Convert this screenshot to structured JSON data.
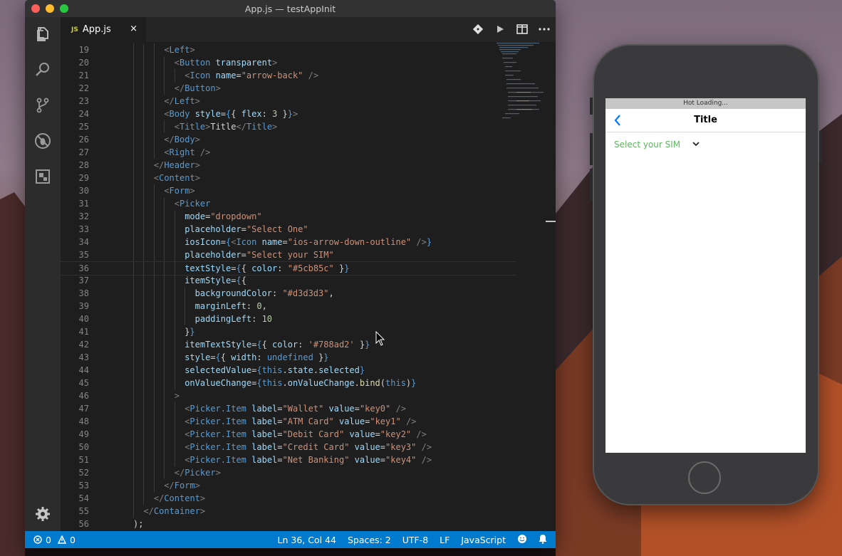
{
  "window": {
    "title": "App.js — testAppInit"
  },
  "tab": {
    "badge": "JS",
    "name": "App.js",
    "close": "×"
  },
  "icons": {
    "activity": [
      "explorer-icon",
      "search-icon",
      "source-control-icon",
      "debug-icon",
      "extensions-icon",
      "settings-gear-icon"
    ],
    "toolbar": [
      "git-compare-icon",
      "run-icon",
      "split-editor-icon",
      "more-actions-icon"
    ]
  },
  "lines": [
    {
      "n": "19",
      "i": 5,
      "t": [
        [
          "tg",
          "<"
        ],
        [
          "tn",
          "Left"
        ],
        [
          "tg",
          ">"
        ]
      ]
    },
    {
      "n": "20",
      "i": 6,
      "t": [
        [
          "tg",
          "<"
        ],
        [
          "tn",
          "Button"
        ],
        [
          "pl",
          " "
        ],
        [
          "at",
          "transparent"
        ],
        [
          "tg",
          ">"
        ]
      ]
    },
    {
      "n": "21",
      "i": 7,
      "t": [
        [
          "tg",
          "<"
        ],
        [
          "tn",
          "Icon"
        ],
        [
          "pl",
          " "
        ],
        [
          "at",
          "name"
        ],
        [
          "pl",
          "="
        ],
        [
          "st",
          "\"arrow-back\""
        ],
        [
          "pl",
          " "
        ],
        [
          "tg",
          "/>"
        ]
      ]
    },
    {
      "n": "22",
      "i": 6,
      "t": [
        [
          "tg",
          "</"
        ],
        [
          "tn",
          "Button"
        ],
        [
          "tg",
          ">"
        ]
      ]
    },
    {
      "n": "23",
      "i": 5,
      "t": [
        [
          "tg",
          "</"
        ],
        [
          "tn",
          "Left"
        ],
        [
          "tg",
          ">"
        ]
      ]
    },
    {
      "n": "24",
      "i": 5,
      "t": [
        [
          "tg",
          "<"
        ],
        [
          "tn",
          "Body"
        ],
        [
          "pl",
          " "
        ],
        [
          "at",
          "style"
        ],
        [
          "pl",
          "="
        ],
        [
          "kw",
          "{"
        ],
        [
          "pl",
          "{ "
        ],
        [
          "at",
          "flex"
        ],
        [
          "pl",
          ": "
        ],
        [
          "nm",
          "3"
        ],
        [
          "pl",
          " }"
        ],
        [
          "kw",
          "}"
        ],
        [
          "tg",
          ">"
        ]
      ]
    },
    {
      "n": "25",
      "i": 6,
      "t": [
        [
          "tg",
          "<"
        ],
        [
          "tn",
          "Title"
        ],
        [
          "tg",
          ">"
        ],
        [
          "pl",
          "Title"
        ],
        [
          "tg",
          "</"
        ],
        [
          "tn",
          "Title"
        ],
        [
          "tg",
          ">"
        ]
      ]
    },
    {
      "n": "26",
      "i": 5,
      "t": [
        [
          "tg",
          "</"
        ],
        [
          "tn",
          "Body"
        ],
        [
          "tg",
          ">"
        ]
      ]
    },
    {
      "n": "27",
      "i": 5,
      "t": [
        [
          "tg",
          "<"
        ],
        [
          "tn",
          "Right"
        ],
        [
          "pl",
          " "
        ],
        [
          "tg",
          "/>"
        ]
      ]
    },
    {
      "n": "28",
      "i": 4,
      "t": [
        [
          "tg",
          "</"
        ],
        [
          "tn",
          "Header"
        ],
        [
          "tg",
          ">"
        ]
      ]
    },
    {
      "n": "29",
      "i": 4,
      "t": [
        [
          "tg",
          "<"
        ],
        [
          "tn",
          "Content"
        ],
        [
          "tg",
          ">"
        ]
      ]
    },
    {
      "n": "30",
      "i": 5,
      "t": [
        [
          "tg",
          "<"
        ],
        [
          "tn",
          "Form"
        ],
        [
          "tg",
          ">"
        ]
      ]
    },
    {
      "n": "31",
      "i": 6,
      "t": [
        [
          "tg",
          "<"
        ],
        [
          "tn",
          "Picker"
        ]
      ]
    },
    {
      "n": "32",
      "i": 7,
      "t": [
        [
          "at",
          "mode"
        ],
        [
          "pl",
          "="
        ],
        [
          "st",
          "\"dropdown\""
        ]
      ]
    },
    {
      "n": "33",
      "i": 7,
      "t": [
        [
          "at",
          "placeholder"
        ],
        [
          "pl",
          "="
        ],
        [
          "st",
          "\"Select One\""
        ]
      ]
    },
    {
      "n": "34",
      "i": 7,
      "t": [
        [
          "at",
          "iosIcon"
        ],
        [
          "pl",
          "="
        ],
        [
          "kw",
          "{"
        ],
        [
          "tg",
          "<"
        ],
        [
          "tn",
          "Icon"
        ],
        [
          "pl",
          " "
        ],
        [
          "at",
          "name"
        ],
        [
          "pl",
          "="
        ],
        [
          "st",
          "\"ios-arrow-down-outline\""
        ],
        [
          "pl",
          " "
        ],
        [
          "tg",
          "/>"
        ],
        [
          "kw",
          "}"
        ]
      ]
    },
    {
      "n": "35",
      "i": 7,
      "t": [
        [
          "at",
          "placeholder"
        ],
        [
          "pl",
          "="
        ],
        [
          "st",
          "\"Select your SIM\""
        ]
      ]
    },
    {
      "n": "36",
      "i": 7,
      "t": [
        [
          "at",
          "textStyle"
        ],
        [
          "pl",
          "="
        ],
        [
          "kw",
          "{"
        ],
        [
          "pl",
          "{ "
        ],
        [
          "at",
          "color"
        ],
        [
          "pl",
          ": "
        ],
        [
          "st",
          "\"#5cb85c\""
        ],
        [
          "pl",
          " }"
        ],
        [
          "kw",
          "}"
        ]
      ]
    },
    {
      "n": "37",
      "i": 7,
      "t": [
        [
          "at",
          "itemStyle"
        ],
        [
          "pl",
          "="
        ],
        [
          "kw",
          "{"
        ],
        [
          "pl",
          "{"
        ]
      ]
    },
    {
      "n": "38",
      "i": 8,
      "t": [
        [
          "at",
          "backgroundColor"
        ],
        [
          "pl",
          ": "
        ],
        [
          "st",
          "\"#d3d3d3\""
        ],
        [
          "pl",
          ","
        ]
      ]
    },
    {
      "n": "39",
      "i": 8,
      "t": [
        [
          "at",
          "marginLeft"
        ],
        [
          "pl",
          ": "
        ],
        [
          "nm",
          "0"
        ],
        [
          "pl",
          ","
        ]
      ]
    },
    {
      "n": "40",
      "i": 8,
      "t": [
        [
          "at",
          "paddingLeft"
        ],
        [
          "pl",
          ": "
        ],
        [
          "nm",
          "10"
        ]
      ]
    },
    {
      "n": "41",
      "i": 7,
      "t": [
        [
          "pl",
          "}"
        ],
        [
          "kw",
          "}"
        ]
      ]
    },
    {
      "n": "42",
      "i": 7,
      "t": [
        [
          "at",
          "itemTextStyle"
        ],
        [
          "pl",
          "="
        ],
        [
          "kw",
          "{"
        ],
        [
          "pl",
          "{ "
        ],
        [
          "at",
          "color"
        ],
        [
          "pl",
          ": "
        ],
        [
          "st",
          "'#788ad2'"
        ],
        [
          "pl",
          " }"
        ],
        [
          "kw",
          "}"
        ]
      ]
    },
    {
      "n": "43",
      "i": 7,
      "t": [
        [
          "at",
          "style"
        ],
        [
          "pl",
          "="
        ],
        [
          "kw",
          "{"
        ],
        [
          "pl",
          "{ "
        ],
        [
          "at",
          "width"
        ],
        [
          "pl",
          ": "
        ],
        [
          "kw",
          "undefined"
        ],
        [
          "pl",
          " }"
        ],
        [
          "kw",
          "}"
        ]
      ]
    },
    {
      "n": "44",
      "i": 7,
      "t": [
        [
          "at",
          "selectedValue"
        ],
        [
          "pl",
          "="
        ],
        [
          "kw",
          "{"
        ],
        [
          "kw",
          "this"
        ],
        [
          "pl",
          "."
        ],
        [
          "at",
          "state"
        ],
        [
          "pl",
          "."
        ],
        [
          "at",
          "selected"
        ],
        [
          "kw",
          "}"
        ]
      ]
    },
    {
      "n": "45",
      "i": 7,
      "t": [
        [
          "at",
          "onValueChange"
        ],
        [
          "pl",
          "="
        ],
        [
          "kw",
          "{"
        ],
        [
          "kw",
          "this"
        ],
        [
          "pl",
          "."
        ],
        [
          "at",
          "onValueChange"
        ],
        [
          "pl",
          "."
        ],
        [
          "fn",
          "bind"
        ],
        [
          "pl",
          "("
        ],
        [
          "kw",
          "this"
        ],
        [
          "pl",
          ")"
        ],
        [
          "kw",
          "}"
        ]
      ]
    },
    {
      "n": "46",
      "i": 6,
      "t": [
        [
          "tg",
          ">"
        ]
      ]
    },
    {
      "n": "47",
      "i": 7,
      "t": [
        [
          "tg",
          "<"
        ],
        [
          "tn",
          "Picker.Item"
        ],
        [
          "pl",
          " "
        ],
        [
          "at",
          "label"
        ],
        [
          "pl",
          "="
        ],
        [
          "st",
          "\"Wallet\""
        ],
        [
          "pl",
          " "
        ],
        [
          "at",
          "value"
        ],
        [
          "pl",
          "="
        ],
        [
          "st",
          "\"key0\""
        ],
        [
          "pl",
          " "
        ],
        [
          "tg",
          "/>"
        ]
      ]
    },
    {
      "n": "48",
      "i": 7,
      "t": [
        [
          "tg",
          "<"
        ],
        [
          "tn",
          "Picker.Item"
        ],
        [
          "pl",
          " "
        ],
        [
          "at",
          "label"
        ],
        [
          "pl",
          "="
        ],
        [
          "st",
          "\"ATM Card\""
        ],
        [
          "pl",
          " "
        ],
        [
          "at",
          "value"
        ],
        [
          "pl",
          "="
        ],
        [
          "st",
          "\"key1\""
        ],
        [
          "pl",
          " "
        ],
        [
          "tg",
          "/>"
        ]
      ]
    },
    {
      "n": "49",
      "i": 7,
      "t": [
        [
          "tg",
          "<"
        ],
        [
          "tn",
          "Picker.Item"
        ],
        [
          "pl",
          " "
        ],
        [
          "at",
          "label"
        ],
        [
          "pl",
          "="
        ],
        [
          "st",
          "\"Debit Card\""
        ],
        [
          "pl",
          " "
        ],
        [
          "at",
          "value"
        ],
        [
          "pl",
          "="
        ],
        [
          "st",
          "\"key2\""
        ],
        [
          "pl",
          " "
        ],
        [
          "tg",
          "/>"
        ]
      ]
    },
    {
      "n": "50",
      "i": 7,
      "t": [
        [
          "tg",
          "<"
        ],
        [
          "tn",
          "Picker.Item"
        ],
        [
          "pl",
          " "
        ],
        [
          "at",
          "label"
        ],
        [
          "pl",
          "="
        ],
        [
          "st",
          "\"Credit Card\""
        ],
        [
          "pl",
          " "
        ],
        [
          "at",
          "value"
        ],
        [
          "pl",
          "="
        ],
        [
          "st",
          "\"key3\""
        ],
        [
          "pl",
          " "
        ],
        [
          "tg",
          "/>"
        ]
      ]
    },
    {
      "n": "51",
      "i": 7,
      "t": [
        [
          "tg",
          "<"
        ],
        [
          "tn",
          "Picker.Item"
        ],
        [
          "pl",
          " "
        ],
        [
          "at",
          "label"
        ],
        [
          "pl",
          "="
        ],
        [
          "st",
          "\"Net Banking\""
        ],
        [
          "pl",
          " "
        ],
        [
          "at",
          "value"
        ],
        [
          "pl",
          "="
        ],
        [
          "st",
          "\"key4\""
        ],
        [
          "pl",
          " "
        ],
        [
          "tg",
          "/>"
        ]
      ]
    },
    {
      "n": "52",
      "i": 6,
      "t": [
        [
          "tg",
          "</"
        ],
        [
          "tn",
          "Picker"
        ],
        [
          "tg",
          ">"
        ]
      ]
    },
    {
      "n": "53",
      "i": 5,
      "t": [
        [
          "tg",
          "</"
        ],
        [
          "tn",
          "Form"
        ],
        [
          "tg",
          ">"
        ]
      ]
    },
    {
      "n": "54",
      "i": 4,
      "t": [
        [
          "tg",
          "</"
        ],
        [
          "tn",
          "Content"
        ],
        [
          "tg",
          ">"
        ]
      ]
    },
    {
      "n": "55",
      "i": 3,
      "t": [
        [
          "tg",
          "</"
        ],
        [
          "tn",
          "Container"
        ],
        [
          "tg",
          ">"
        ]
      ]
    },
    {
      "n": "56",
      "i": 2,
      "t": [
        [
          "pl",
          ");"
        ]
      ]
    }
  ],
  "current_line": "36",
  "status": {
    "errors": "0",
    "warnings": "0",
    "position": "Ln 36, Col 44",
    "spaces": "Spaces: 2",
    "encoding": "UTF-8",
    "eol": "LF",
    "language": "JavaScript"
  },
  "phone": {
    "banner": "Hot Loading...",
    "title": "Title",
    "picker_placeholder": "Select your SIM",
    "picker_color": "#5cb85c"
  },
  "colors": {
    "status_bar": "#007acc",
    "editor_bg": "#1e1e1e",
    "activity_bar": "#2c2c2c"
  }
}
